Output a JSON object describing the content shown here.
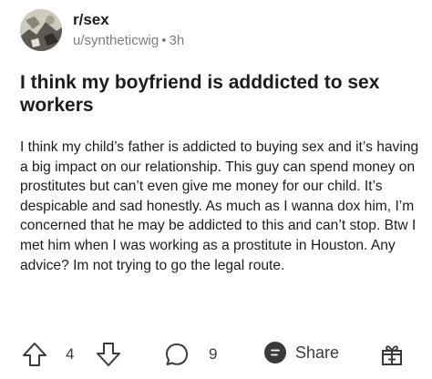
{
  "post": {
    "subreddit": "r/sex",
    "username": "u/syntheticwig",
    "separator": "•",
    "age": "3h",
    "title": "I think my boyfriend is adddicted to sex workers",
    "body": "I think my child’s father is addicted to buying sex and it’s having a big impact on our relationship. This guy can spend money on prostitutes but can’t even give me money for our child. It’s despicable and sad honestly. As much as I wanna dox him, I’m concerned that he may be addicted to this and can’t stop. Btw I met him when I was working as a prostitute in Houston. Any advice? Im not trying to go the legal route."
  },
  "actions": {
    "upvote_icon": "arrow-up-icon",
    "vote_count": "4",
    "downvote_icon": "arrow-down-icon",
    "comment_icon": "comment-bubble-icon",
    "comment_count": "9",
    "share_icon": "share-icon",
    "share_label": "Share",
    "award_icon": "gift-award-icon"
  },
  "colors": {
    "text": "#1c1c1c",
    "muted": "#7c7c7c",
    "icon": "#3a3a3a",
    "background": "#ffffff"
  }
}
